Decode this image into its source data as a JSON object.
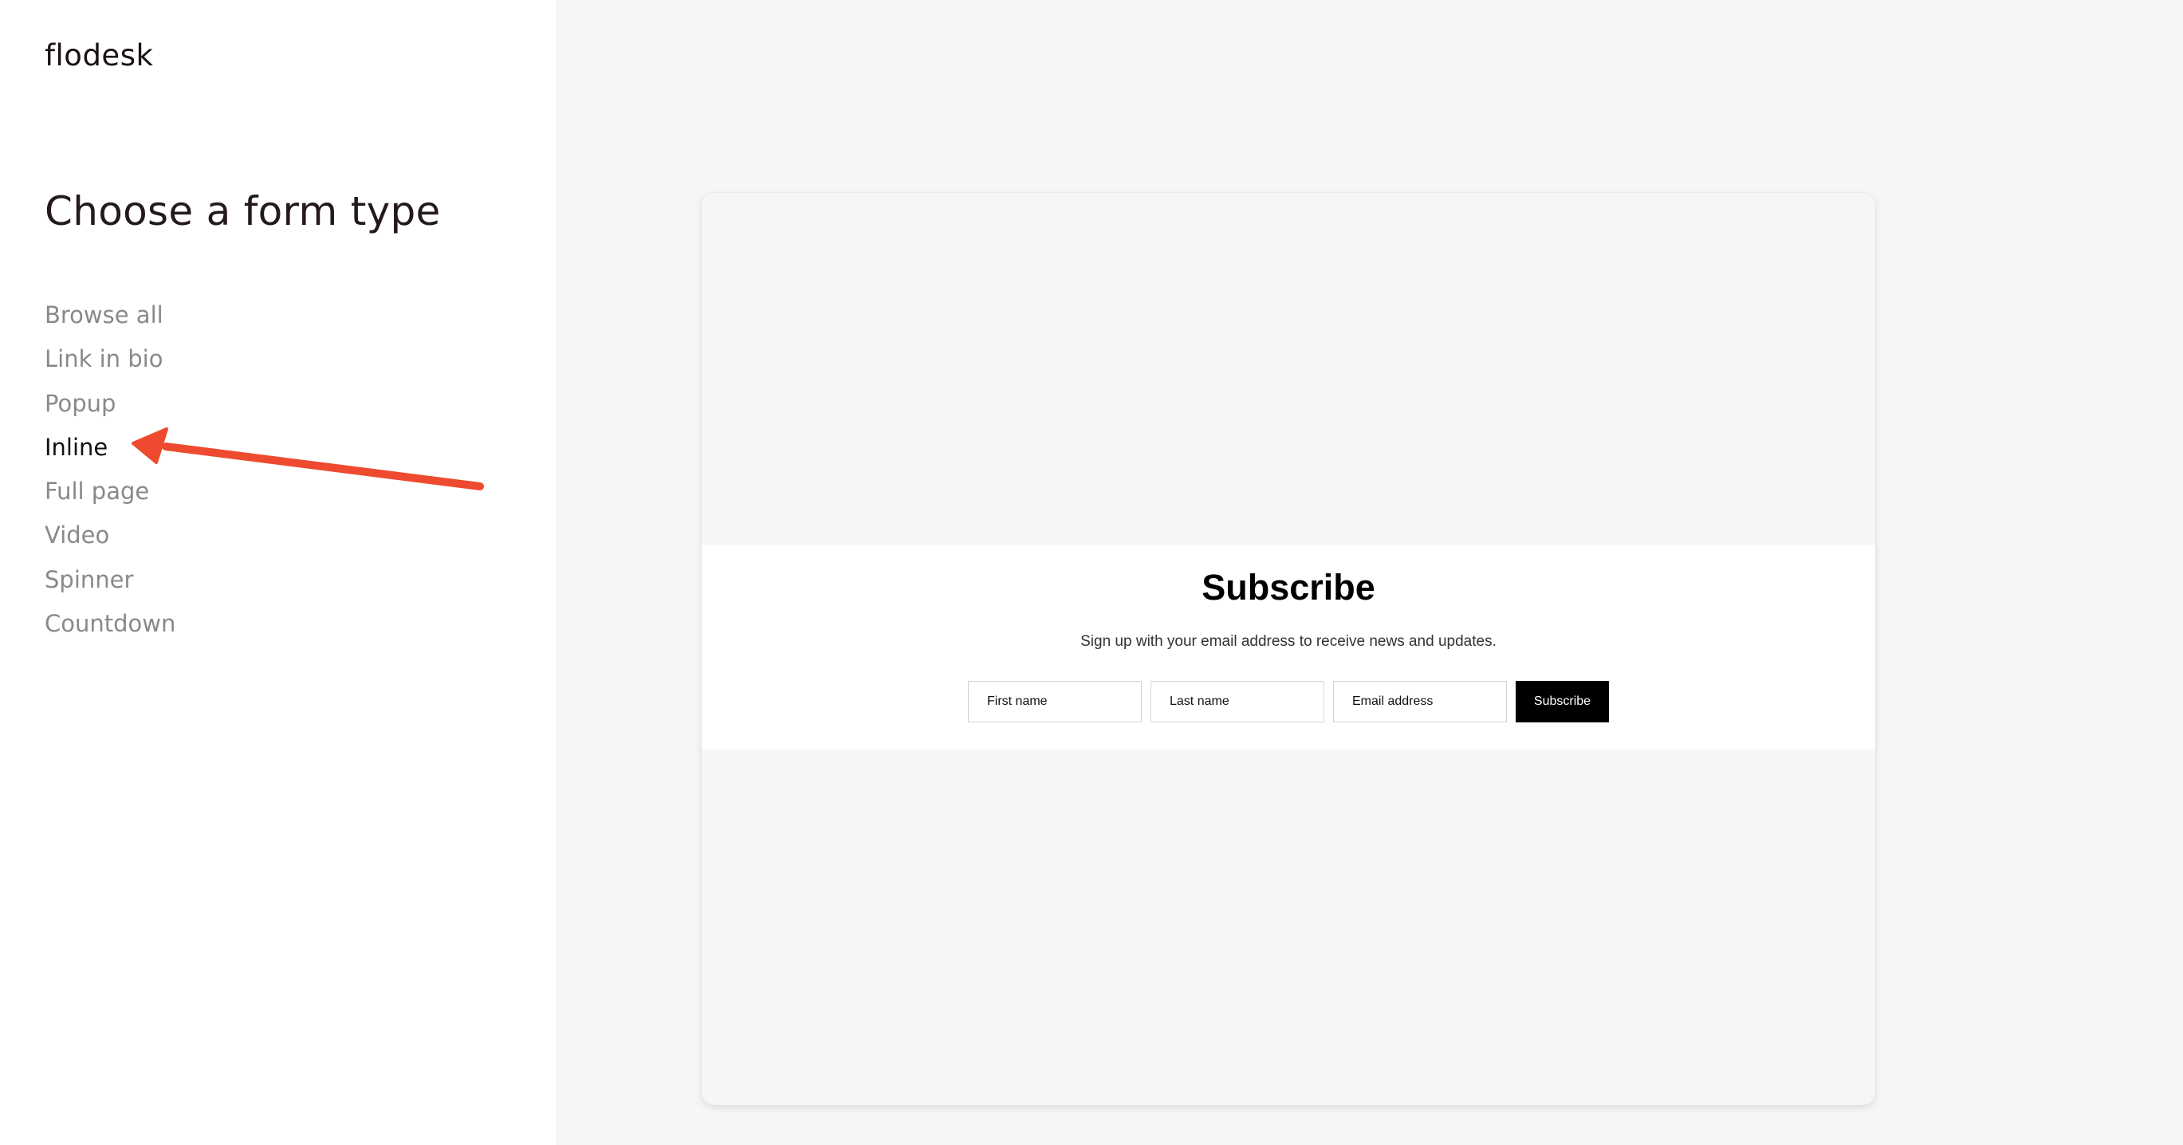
{
  "brand": {
    "name": "flodesk"
  },
  "sidebar": {
    "heading": "Choose a form type",
    "items": [
      {
        "label": "Browse all",
        "active": false
      },
      {
        "label": "Link in bio",
        "active": false
      },
      {
        "label": "Popup",
        "active": false
      },
      {
        "label": "Inline",
        "active": true
      },
      {
        "label": "Full page",
        "active": false
      },
      {
        "label": "Video",
        "active": false
      },
      {
        "label": "Spinner",
        "active": false
      },
      {
        "label": "Countdown",
        "active": false
      }
    ]
  },
  "annotation": {
    "arrow_color": "#ee4a2f",
    "points_to": "Inline"
  },
  "preview": {
    "title": "Subscribe",
    "subtitle": "Sign up with your email address to receive news and updates.",
    "fields": {
      "first_name_placeholder": "First name",
      "last_name_placeholder": "Last name",
      "email_placeholder": "Email address"
    },
    "button_label": "Subscribe"
  },
  "colors": {
    "sidebar_bg": "#ffffff",
    "canvas_bg": "#f6f6f6",
    "active_text": "#111111",
    "inactive_text": "#8d8888",
    "button_bg": "#000000",
    "button_text": "#ffffff"
  }
}
